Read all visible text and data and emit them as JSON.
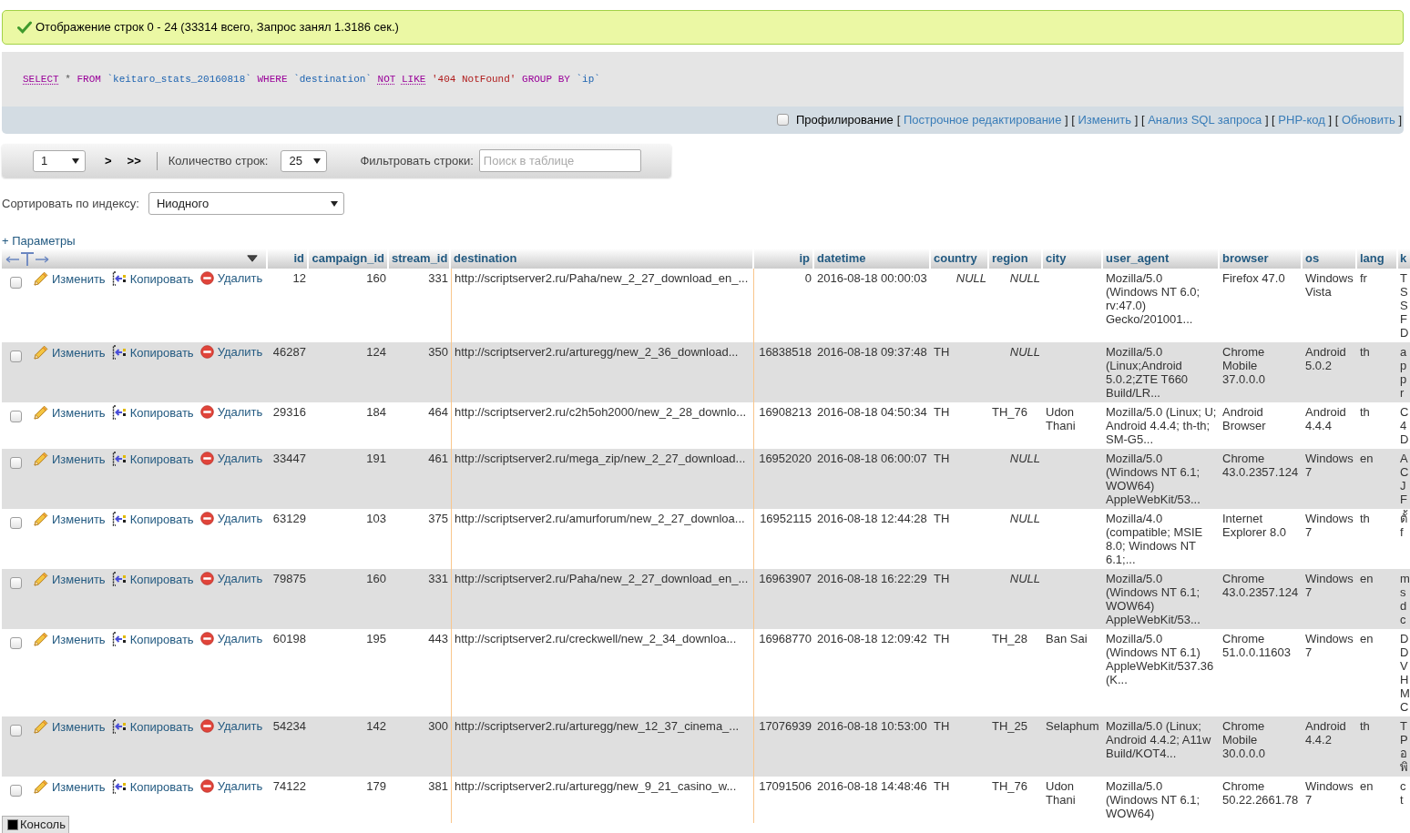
{
  "message": {
    "text": "Отображение строк 0 - 24 (33314 всего, Запрос занял 1.3186 сек.)"
  },
  "sql": {
    "tokens": [
      {
        "kind": "doc_keyword",
        "text": "SELECT"
      },
      {
        "kind": "operator",
        "text": "*"
      },
      {
        "kind": "keyword",
        "text": "FROM"
      },
      {
        "kind": "identifier",
        "text": "`keitaro_stats_20160818`"
      },
      {
        "kind": "keyword",
        "text": "WHERE"
      },
      {
        "kind": "identifier",
        "text": "`destination`"
      },
      {
        "kind": "doc_keyword",
        "text": "NOT"
      },
      {
        "kind": "doc_keyword",
        "text": "LIKE"
      },
      {
        "kind": "string",
        "text": "'404 NotFound'"
      },
      {
        "kind": "keyword",
        "text": "GROUP BY"
      },
      {
        "kind": "identifier",
        "text": "`ip`"
      }
    ]
  },
  "query_toolbar": {
    "profiling": {
      "label": "Профилирование",
      "checked": false
    },
    "items": [
      {
        "kind": "bracket",
        "text": "["
      },
      {
        "kind": "link",
        "text": "Построчное редактирование"
      },
      {
        "kind": "bracket",
        "text": "] ["
      },
      {
        "kind": "link",
        "text": "Изменить"
      },
      {
        "kind": "bracket",
        "text": "] ["
      },
      {
        "kind": "link",
        "text": "Анализ SQL запроса"
      },
      {
        "kind": "bracket",
        "text": "] ["
      },
      {
        "kind": "link",
        "text": "PHP-код"
      },
      {
        "kind": "bracket",
        "text": "] ["
      },
      {
        "kind": "link",
        "text": "Обновить"
      },
      {
        "kind": "bracket",
        "text": "]"
      }
    ]
  },
  "navigation": {
    "page_select": {
      "value": "1"
    },
    "buttons": [
      ">",
      ">>"
    ],
    "rows_label": "Количество строк:",
    "rows_select": {
      "value": "25"
    },
    "filter_label": "Фильтровать строки:",
    "filter_field": {
      "placeholder": "Поиск в таблице"
    }
  },
  "sort": {
    "label": "Сортировать по индексу:",
    "select": {
      "value": "Ниодного"
    }
  },
  "options_link": "+ Параметры",
  "table": {
    "columns": [
      "id",
      "campaign_id",
      "stream_id",
      "destination",
      "ip",
      "datetime",
      "country",
      "region",
      "city",
      "user_agent",
      "browser",
      "os",
      "lang",
      "k"
    ],
    "rows": [
      {
        "checked": false,
        "actions": [
          {
            "kind": "edit",
            "label": "Изменить"
          },
          {
            "kind": "copy",
            "label": "Копировать"
          },
          {
            "kind": "delete",
            "label": "Удалить"
          }
        ],
        "cells": [
          "12",
          "160",
          "331",
          "http://scriptserver2.ru/Paha/new_2_27_download_en_...",
          "0",
          "2016-08-18 00:00:03",
          {
            "kind": "null",
            "text": "NULL"
          },
          {
            "kind": "null",
            "text": "NULL"
          },
          null,
          "Mozilla/5.0 (Windows NT 6.0; rv:47.0) Gecko/201001...",
          "Firefox 47.0",
          "Windows Vista",
          "fr",
          {
            "kind": "clipped",
            "lines": [
              "T",
              "S",
              "S",
              "F",
              "D"
            ]
          }
        ]
      },
      {
        "checked": false,
        "actions": [
          {
            "kind": "edit",
            "label": "Изменить"
          },
          {
            "kind": "copy",
            "label": "Копировать"
          },
          {
            "kind": "delete",
            "label": "Удалить"
          }
        ],
        "cells": [
          "46287",
          "124",
          "350",
          "http://scriptserver2.ru/arturegg/new_2_36_download...",
          "16838518",
          "2016-08-18 09:37:48",
          "TH",
          {
            "kind": "null",
            "text": "NULL"
          },
          null,
          "Mozilla/5.0 (Linux;Android 5.0.2;ZTE T660 Build/LR...",
          "Chrome Mobile 37.0.0.0",
          "Android 5.0.2",
          "th",
          {
            "kind": "clipped",
            "lines": [
              "a",
              "p",
              "p",
              "r"
            ]
          }
        ]
      },
      {
        "checked": false,
        "actions": [
          {
            "kind": "edit",
            "label": "Изменить"
          },
          {
            "kind": "copy",
            "label": "Копировать"
          },
          {
            "kind": "delete",
            "label": "Удалить"
          }
        ],
        "cells": [
          "29316",
          "184",
          "464",
          "http://scriptserver2.ru/c2h5oh2000/new_2_28_downlo...",
          "16908213",
          "2016-08-18 04:50:34",
          "TH",
          "TH_76",
          "Udon Thani",
          "Mozilla/5.0 (Linux; U; Android 4.4.4; th-th; SM-G5...",
          "Android Browser",
          "Android 4.4.4",
          "th",
          {
            "kind": "clipped",
            "lines": [
              "C",
              "4",
              "D"
            ]
          }
        ]
      },
      {
        "checked": false,
        "actions": [
          {
            "kind": "edit",
            "label": "Изменить"
          },
          {
            "kind": "copy",
            "label": "Копировать"
          },
          {
            "kind": "delete",
            "label": "Удалить"
          }
        ],
        "cells": [
          "33447",
          "191",
          "461",
          "http://scriptserver2.ru/mega_zip/new_2_27_download...",
          "16952020",
          "2016-08-18 06:00:07",
          "TH",
          {
            "kind": "null",
            "text": "NULL"
          },
          null,
          "Mozilla/5.0 (Windows NT 6.1; WOW64) AppleWebKit/53...",
          "Chrome 43.0.2357.124",
          "Windows 7",
          "en",
          {
            "kind": "clipped",
            "lines": [
              "A",
              "C",
              "J",
              "F"
            ]
          }
        ]
      },
      {
        "checked": false,
        "actions": [
          {
            "kind": "edit",
            "label": "Изменить"
          },
          {
            "kind": "copy",
            "label": "Копировать"
          },
          {
            "kind": "delete",
            "label": "Удалить"
          }
        ],
        "cells": [
          "63129",
          "103",
          "375",
          "http://scriptserver2.ru/amurforum/new_2_27_downloa...",
          "16952115",
          "2016-08-18 12:44:28",
          "TH",
          {
            "kind": "null",
            "text": "NULL"
          },
          null,
          "Mozilla/4.0 (compatible; MSIE 8.0; Windows NT 6.1;...",
          "Internet Explorer 8.0",
          "Windows 7",
          "th",
          {
            "kind": "clipped",
            "lines": [
              "ตั้",
              "f"
            ]
          }
        ]
      },
      {
        "checked": false,
        "actions": [
          {
            "kind": "edit",
            "label": "Изменить"
          },
          {
            "kind": "copy",
            "label": "Копировать"
          },
          {
            "kind": "delete",
            "label": "Удалить"
          }
        ],
        "cells": [
          "79875",
          "160",
          "331",
          "http://scriptserver2.ru/Paha/new_2_27_download_en_...",
          "16963907",
          "2016-08-18 16:22:29",
          "TH",
          {
            "kind": "null",
            "text": "NULL"
          },
          null,
          "Mozilla/5.0 (Windows NT 6.1; WOW64) AppleWebKit/53...",
          "Chrome 43.0.2357.124",
          "Windows 7",
          "en",
          {
            "kind": "clipped",
            "lines": [
              "m",
              "s",
              "d",
              "c"
            ]
          }
        ]
      },
      {
        "checked": false,
        "actions": [
          {
            "kind": "edit",
            "label": "Изменить"
          },
          {
            "kind": "copy",
            "label": "Копировать"
          },
          {
            "kind": "delete",
            "label": "Удалить"
          }
        ],
        "cells": [
          "60198",
          "195",
          "443",
          "http://scriptserver2.ru/creckwell/new_2_34_downloa...",
          "16968770",
          "2016-08-18 12:09:42",
          "TH",
          "TH_28",
          "Ban Sai",
          "Mozilla/5.0 (Windows NT 6.1) AppleWebKit/537.36 (K...",
          "Chrome 51.0.0.11603",
          "Windows 7",
          "en",
          {
            "kind": "clipped",
            "lines": [
              "D",
              "D",
              "V",
              "H",
              "M",
              "C"
            ]
          }
        ]
      },
      {
        "checked": false,
        "actions": [
          {
            "kind": "edit",
            "label": "Изменить"
          },
          {
            "kind": "copy",
            "label": "Копировать"
          },
          {
            "kind": "delete",
            "label": "Удалить"
          }
        ],
        "cells": [
          "54234",
          "142",
          "300",
          "http://scriptserver2.ru/arturegg/new_12_37_cinema_...",
          "17076939",
          "2016-08-18 10:53:00",
          "TH",
          "TH_25",
          "Selaphum",
          "Mozilla/5.0 (Linux; Android 4.4.2; A11w Build/KOT4...",
          "Chrome Mobile 30.0.0.0",
          "Android 4.4.2",
          "th",
          {
            "kind": "clipped",
            "lines": [
              "T",
              "P",
              "อ",
              "พิ"
            ]
          }
        ]
      },
      {
        "checked": false,
        "actions": [
          {
            "kind": "edit",
            "label": "Изменить"
          },
          {
            "kind": "copy",
            "label": "Копировать"
          },
          {
            "kind": "delete",
            "label": "Удалить"
          }
        ],
        "cells": [
          "74122",
          "179",
          "381",
          "http://scriptserver2.ru/arturegg/new_9_21_casino_w...",
          "17091506",
          "2016-08-18 14:48:46",
          "TH",
          "TH_76",
          "Udon Thani",
          "Mozilla/5.0 (Windows NT 6.1; WOW64)",
          "Chrome 50.22.2661.78",
          "Windows 7",
          "en",
          {
            "kind": "clipped",
            "lines": [
              "c",
              "t"
            ]
          }
        ]
      }
    ]
  },
  "console": {
    "label": "Консоль"
  }
}
